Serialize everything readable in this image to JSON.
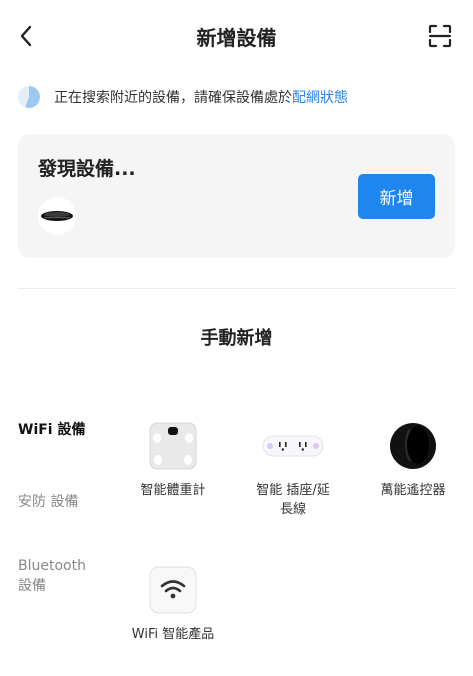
{
  "header": {
    "title": "新增設備"
  },
  "search": {
    "text": "正在搜索附近的設備，請確保設備處於",
    "link": "配網狀態"
  },
  "found": {
    "title": "發現設備...",
    "add_label": "新增"
  },
  "manual": {
    "title": "手動新增"
  },
  "categories": [
    {
      "label": "WiFi 設備"
    },
    {
      "label": "安防 設備"
    },
    {
      "label": "Bluetooth\n設備"
    }
  ],
  "products": [
    {
      "label": "智能體重計",
      "icon": "scale-icon"
    },
    {
      "label": "智能 插座/延\n長線",
      "icon": "power-strip-icon"
    },
    {
      "label": "萬能遙控器",
      "icon": "remote-icon"
    },
    {
      "label": "WiFi 智能產品",
      "icon": "wifi-icon"
    }
  ],
  "colors": {
    "accent": "#1f86f0",
    "link": "#2d84e8",
    "card_bg": "#f5f5f6"
  }
}
